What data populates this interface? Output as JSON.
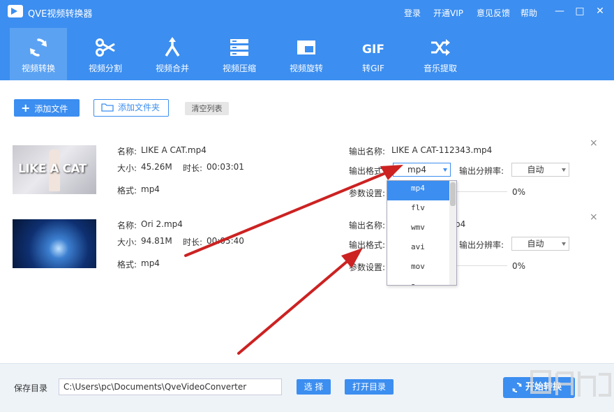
{
  "app": {
    "title": "QVE视频转换器",
    "top_links": [
      "登录",
      "开通VIP",
      "意见反馈",
      "帮助"
    ],
    "window_controls": {
      "minimize": "—",
      "maximize": "□",
      "close": "✕"
    }
  },
  "tabs": [
    {
      "label": "视频转换",
      "icon": "convert-icon",
      "active": true
    },
    {
      "label": "视频分割",
      "icon": "scissors-icon"
    },
    {
      "label": "视频合并",
      "icon": "merge-icon"
    },
    {
      "label": "视频压缩",
      "icon": "compress-icon"
    },
    {
      "label": "视频旋转",
      "icon": "rotate-icon"
    },
    {
      "label": "转GIF",
      "icon": "gif-icon"
    },
    {
      "label": "音乐提取",
      "icon": "shuffle-icon"
    }
  ],
  "toolbar": {
    "add_file": "添加文件",
    "add_folder": "添加文件夹",
    "clear_list": "清空列表"
  },
  "files": [
    {
      "thumb_text": "LIKE A CAT",
      "name_label": "名称:",
      "name": "LIKE A CAT.mp4",
      "size_label": "大小:",
      "size": "45.26M",
      "duration_label": "时长:",
      "duration": "00:03:01",
      "format_label": "格式:",
      "format": "mp4",
      "output_name_label": "输出名称:",
      "output_name": "LIKE A CAT-112343.mp4",
      "output_format_label": "输出格式:",
      "output_format": "mp4",
      "resolution_label": "输出分辨率:",
      "resolution": "自动",
      "params_label": "参数设置:",
      "progress": "0%"
    },
    {
      "thumb_text": "",
      "name_label": "名称:",
      "name": "Ori 2.mp4",
      "size_label": "大小:",
      "size": "94.81M",
      "duration_label": "时长:",
      "duration": "00:05:40",
      "format_label": "格式:",
      "format": "mp4",
      "output_name_label": "输出名称:",
      "output_name": "p4",
      "output_format_label": "输出格式:",
      "output_format": "",
      "resolution_label": "输出分辨率:",
      "resolution": "自动",
      "params_label": "参数设置:",
      "progress": "0%"
    }
  ],
  "dropdown": {
    "options": [
      "mp4",
      "flv",
      "wmv",
      "avi",
      "mov",
      "a"
    ],
    "selected": "mp4"
  },
  "footer": {
    "save_dir_label": "保存目录",
    "save_dir": "C:\\Users\\pc\\Documents\\QveVideoConverter",
    "choose": "选 择",
    "open_dir": "打开目录",
    "start": "开始转换"
  },
  "colors": {
    "accent": "#3c8ef0",
    "annotation_arrow": "#cc2222"
  }
}
